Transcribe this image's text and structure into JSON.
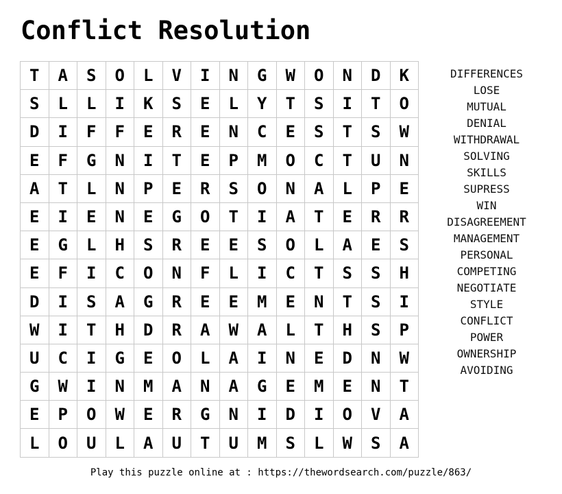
{
  "title": "Conflict Resolution",
  "grid": [
    [
      "T",
      "A",
      "S",
      "O",
      "L",
      "V",
      "I",
      "N",
      "G",
      "W",
      "O",
      "N",
      "D",
      "K"
    ],
    [
      "S",
      "L",
      "L",
      "I",
      "K",
      "S",
      "E",
      "L",
      "Y",
      "T",
      "S",
      "I",
      "T",
      "O"
    ],
    [
      "D",
      "I",
      "F",
      "F",
      "E",
      "R",
      "E",
      "N",
      "C",
      "E",
      "S",
      "T",
      "S",
      "W"
    ],
    [
      "E",
      "F",
      "G",
      "N",
      "I",
      "T",
      "E",
      "P",
      "M",
      "O",
      "C",
      "T",
      "U",
      "N"
    ],
    [
      "A",
      "T",
      "L",
      "N",
      "P",
      "E",
      "R",
      "S",
      "O",
      "N",
      "A",
      "L",
      "P",
      "E"
    ],
    [
      "E",
      "I",
      "E",
      "N",
      "E",
      "G",
      "O",
      "T",
      "I",
      "A",
      "T",
      "E",
      "R",
      "R"
    ],
    [
      "E",
      "G",
      "L",
      "H",
      "S",
      "R",
      "E",
      "E",
      "S",
      "O",
      "L",
      "A",
      "E",
      "S"
    ],
    [
      "E",
      "F",
      "I",
      "C",
      "O",
      "N",
      "F",
      "L",
      "I",
      "C",
      "T",
      "S",
      "S",
      "H"
    ],
    [
      "D",
      "I",
      "S",
      "A",
      "G",
      "R",
      "E",
      "E",
      "M",
      "E",
      "N",
      "T",
      "S",
      "I"
    ],
    [
      "W",
      "I",
      "T",
      "H",
      "D",
      "R",
      "A",
      "W",
      "A",
      "L",
      "T",
      "H",
      "S",
      "P"
    ],
    [
      "U",
      "C",
      "I",
      "G",
      "E",
      "O",
      "L",
      "A",
      "I",
      "N",
      "E",
      "D",
      "N",
      "W"
    ],
    [
      "G",
      "W",
      "I",
      "N",
      "M",
      "A",
      "N",
      "A",
      "G",
      "E",
      "M",
      "E",
      "N",
      "T"
    ],
    [
      "E",
      "P",
      "O",
      "W",
      "E",
      "R",
      "G",
      "N",
      "I",
      "D",
      "I",
      "O",
      "V",
      "A"
    ],
    [
      "L",
      "O",
      "U",
      "L",
      "A",
      "U",
      "T",
      "U",
      "M",
      "S",
      "L",
      "W",
      "S",
      "A"
    ]
  ],
  "words": [
    "DIFFERENCES",
    "LOSE",
    "MUTUAL",
    "DENIAL",
    "WITHDRAWAL",
    "SOLVING",
    "SKILLS",
    "SUPRESS",
    "WIN",
    "DISAGREEMENT",
    "MANAGEMENT",
    "PERSONAL",
    "COMPETING",
    "NEGOTIATE",
    "STYLE",
    "CONFLICT",
    "POWER",
    "OWNERSHIP",
    "AVOIDING"
  ],
  "footer": "Play this puzzle online at : https://thewordsearch.com/puzzle/863/"
}
